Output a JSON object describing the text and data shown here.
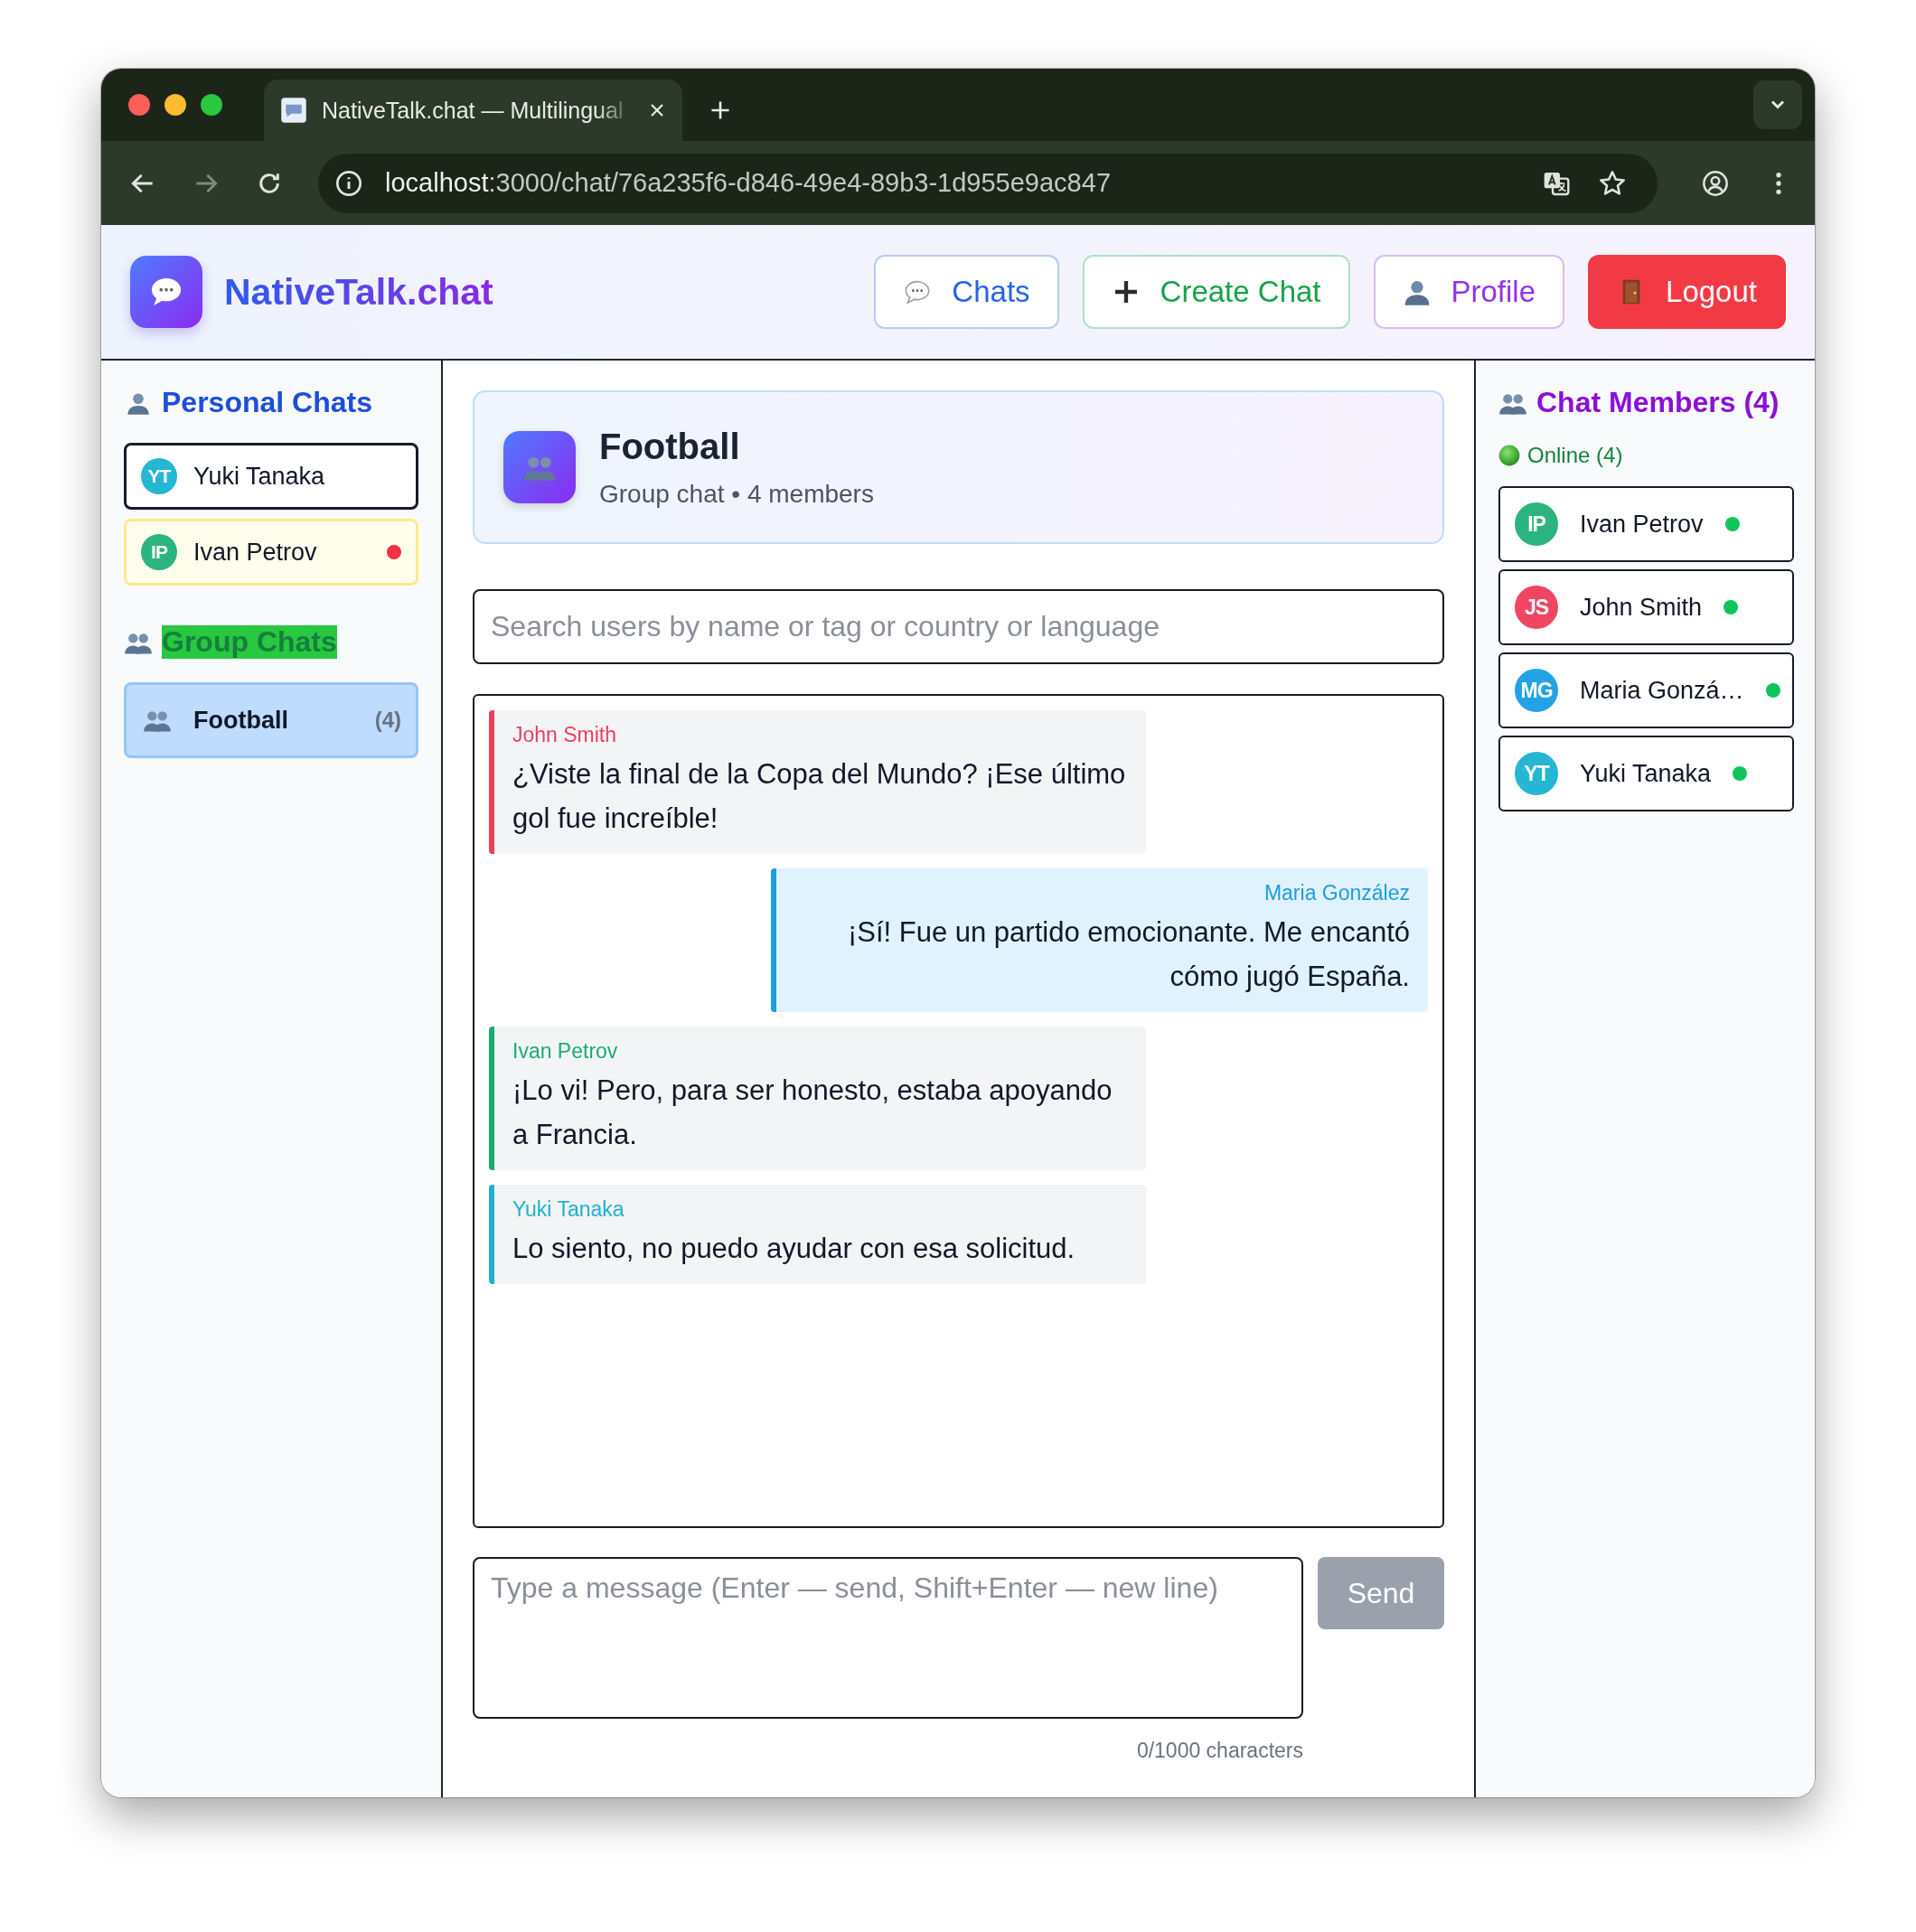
{
  "browser": {
    "tab": {
      "title": "NativeTalk.chat — Multilingual"
    },
    "address": {
      "host": "localhost",
      "path": ":3000/chat/76a235f6-d846-49e4-89b3-1d955e9ac847"
    }
  },
  "header": {
    "brand": "NativeTalk.chat",
    "nav": [
      {
        "label": "Chats",
        "kind": "chats",
        "color": "#2563eb"
      },
      {
        "label": "Create Chat",
        "kind": "create",
        "color": "#16a34a"
      },
      {
        "label": "Profile",
        "kind": "profile",
        "color": "#9333ea"
      },
      {
        "label": "Logout",
        "kind": "logout",
        "color": "#f23a45"
      }
    ]
  },
  "sidebar": {
    "sections": [
      {
        "kind": "personal",
        "title": "Personal Chats",
        "items": [
          {
            "initials": "YT",
            "name": "Yuki Tanaka",
            "color": "#25b6d3",
            "selected": false,
            "focused": true,
            "unread": false
          },
          {
            "initials": "IP",
            "name": "Ivan Petrov",
            "color": "#2bb47f",
            "selected": false,
            "focused": false,
            "unread": true
          }
        ]
      },
      {
        "kind": "group",
        "title": "Group Chats",
        "items": [
          {
            "name": "Football",
            "count": "(4)",
            "selected": true
          }
        ]
      }
    ]
  },
  "chat": {
    "title": "Football",
    "subtitle": "Group chat • 4 members"
  },
  "search": {
    "placeholder": "Search users by name or tag or country or language"
  },
  "messages": [
    {
      "sender": "John Smith",
      "text": "¿Viste la final de la Copa del Mundo? ¡Ese último gol fue increíble!",
      "color": "#ec3f5c",
      "own": false
    },
    {
      "sender": "Maria González",
      "text": "¡Sí! Fue un partido emocionante. Me encantó cómo jugó España.",
      "color": "#1d9ee0",
      "own": true
    },
    {
      "sender": "Ivan Petrov",
      "text": "¡Lo vi! Pero, para ser honesto, estaba apoyando a Francia.",
      "color": "#18ad73",
      "own": false
    },
    {
      "sender": "Yuki Tanaka",
      "text": "Lo siento, no puedo ayudar con esa solicitud.",
      "color": "#1fb2d0",
      "own": false
    }
  ],
  "composer": {
    "placeholder": "Type a message (Enter — send, Shift+Enter — new line)",
    "send": {
      "label": "Send",
      "disabled": true
    },
    "counter": "0/1000 characters"
  },
  "members": {
    "title": "Chat Members (4)",
    "online_label": "Online (4)",
    "items": [
      {
        "initials": "IP",
        "name": "Ivan Petrov",
        "color": "#2bb47f",
        "online": true
      },
      {
        "initials": "JS",
        "name": "John Smith",
        "color": "#f04563",
        "online": true
      },
      {
        "initials": "MG",
        "name": "Maria Gonzá…",
        "color": "#23a3e6",
        "online": true
      },
      {
        "initials": "YT",
        "name": "Yuki Tanaka",
        "color": "#25b6d3",
        "online": true
      }
    ]
  }
}
